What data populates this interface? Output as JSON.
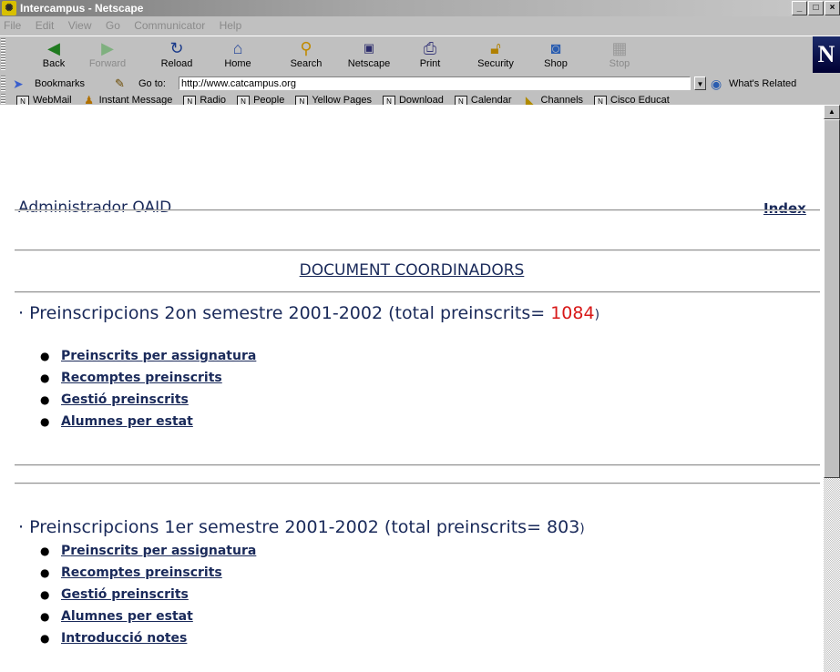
{
  "window": {
    "title": "Intercampus - Netscape",
    "buttons": [
      "_",
      "□",
      "×"
    ]
  },
  "menu": [
    "File",
    "Edit",
    "View",
    "Go",
    "Communicator",
    "Help"
  ],
  "toolbar": {
    "buttons": [
      {
        "label": "Back",
        "icon": "back-arrow-icon",
        "enabled": true
      },
      {
        "label": "Forward",
        "icon": "forward-arrow-icon",
        "enabled": false
      },
      {
        "label": "Reload",
        "icon": "reload-icon",
        "enabled": true
      },
      {
        "label": "Home",
        "icon": "home-icon",
        "enabled": true
      },
      {
        "label": "Search",
        "icon": "search-icon",
        "enabled": true
      },
      {
        "label": "Netscape",
        "icon": "netscape-icon",
        "enabled": true
      },
      {
        "label": "Print",
        "icon": "print-icon",
        "enabled": true
      },
      {
        "label": "Security",
        "icon": "lock-icon",
        "enabled": true
      },
      {
        "label": "Shop",
        "icon": "shop-icon",
        "enabled": true
      },
      {
        "label": "Stop",
        "icon": "stop-icon",
        "enabled": false
      }
    ],
    "logo": "N"
  },
  "location": {
    "bookmarks_label": "Bookmarks",
    "goto_label": "Go to:",
    "url": "http://www.catcampus.org",
    "related_label": "What's Related"
  },
  "personal_toolbar": [
    {
      "label": "WebMail",
      "icon": "bookmark-icon"
    },
    {
      "label": "Instant Message",
      "icon": "person-icon"
    },
    {
      "label": "Radio",
      "icon": "bookmark-icon"
    },
    {
      "label": "People",
      "icon": "bookmark-icon"
    },
    {
      "label": "Yellow Pages",
      "icon": "bookmark-icon"
    },
    {
      "label": "Download",
      "icon": "bookmark-icon"
    },
    {
      "label": "Calendar",
      "icon": "bookmark-icon"
    },
    {
      "label": "Channels",
      "icon": "channels-icon"
    },
    {
      "label": "Cisco Educat",
      "icon": "bookmark-icon"
    }
  ],
  "page": {
    "header_title": "Administrador OAID",
    "index_link": "Index",
    "document_link": "DOCUMENT COORDINADORS",
    "sections": [
      {
        "title": "· Preinscripcions 2on semestre 2001-2002 (total preinscrits= ",
        "total": "1084",
        "close": ")",
        "total_color": "#d81818",
        "links": [
          "Preinscrits per assignatura",
          "Recomptes preinscrits",
          "Gestió preinscrits",
          "Alumnes per estat"
        ]
      },
      {
        "title": "· Preinscripcions 1er semestre 2001-2002 (total preinscrits= ",
        "total": "803",
        "close": ")",
        "total_color": "#1a2a5a",
        "links": [
          "Preinscrits per assignatura",
          "Recomptes preinscrits",
          "Gestió preinscrits",
          "Alumnes per estat",
          "Introducció notes"
        ]
      }
    ]
  }
}
